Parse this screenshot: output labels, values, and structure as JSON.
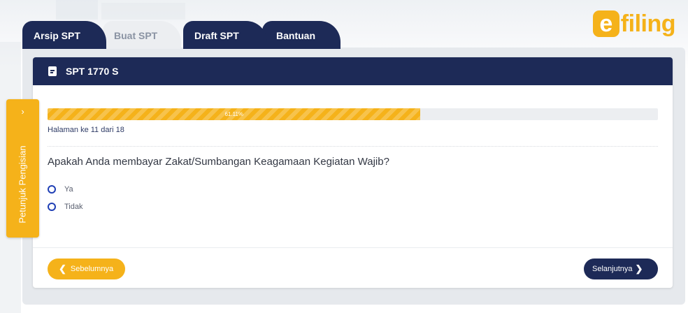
{
  "tabs": [
    {
      "label": "Arsip SPT",
      "active": false
    },
    {
      "label": "Buat SPT",
      "active": true
    },
    {
      "label": "Draft SPT",
      "active": false
    },
    {
      "label": "Bantuan",
      "active": false
    }
  ],
  "logo": {
    "letter": "e",
    "text": "filing"
  },
  "panel": {
    "title": "SPT 1770 S",
    "icon": "document-icon"
  },
  "progress": {
    "percent_label": "61.11%",
    "value": 61.11
  },
  "page_info": "Halaman ke 11 dari 18",
  "question": "Apakah Anda membayar Zakat/Sumbangan Keagamaan Kegiatan Wajib?",
  "options": [
    {
      "label": "Ya",
      "selected": false
    },
    {
      "label": "Tidak",
      "selected": false
    }
  ],
  "buttons": {
    "prev": "Sebelumnya",
    "next": "Selanjutnya"
  },
  "guide": {
    "label": "Petunjuk Pengisian",
    "arrow": "›"
  },
  "colors": {
    "navy": "#1d2a57",
    "accent": "#f5b21a",
    "radio": "#1f3fb5"
  }
}
